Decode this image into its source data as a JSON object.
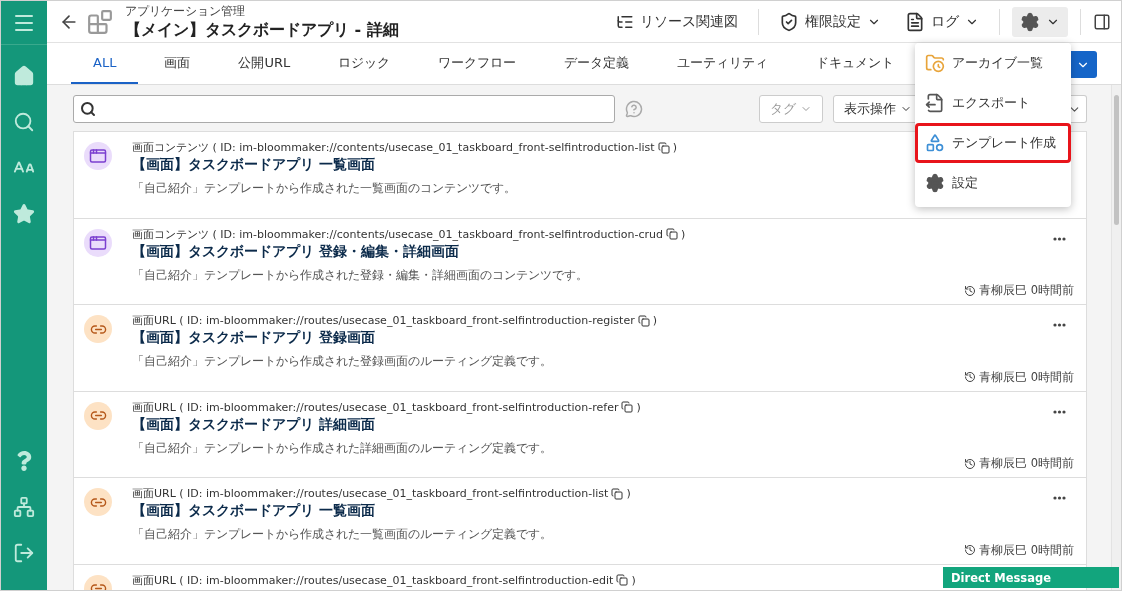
{
  "header": {
    "breadcrumb": "アプリケーション管理",
    "title": "【メイン】タスクボードアプリ - 詳細",
    "actions": [
      {
        "kind": "diagram",
        "label": "リソース関連図",
        "dropdown": false,
        "open": false
      },
      {
        "kind": "permissions",
        "label": "権限設定",
        "dropdown": true,
        "open": false
      },
      {
        "kind": "log",
        "label": "ログ",
        "dropdown": true,
        "open": false
      },
      {
        "kind": "settings",
        "dropdown": true,
        "open": true
      }
    ]
  },
  "tabs": [
    {
      "label": "ALL",
      "selected": true
    },
    {
      "label": "画面",
      "selected": false
    },
    {
      "label": "公開URL",
      "selected": false
    },
    {
      "label": "ロジック",
      "selected": false
    },
    {
      "label": "ワークフロー",
      "selected": false
    },
    {
      "label": "データ定義",
      "selected": false
    },
    {
      "label": "ユーティリティ",
      "selected": false
    },
    {
      "label": "ドキュメント",
      "selected": false
    }
  ],
  "toolbar": {
    "tag_filter": {
      "label": "タグ",
      "disabled": true
    },
    "view_menu": {
      "label": "表示操作",
      "disabled": false
    }
  },
  "settings_menu": {
    "items": [
      {
        "kind": "archive",
        "label": "アーカイブ一覧",
        "highlighted": false
      },
      {
        "kind": "export",
        "label": "エクスポート",
        "highlighted": false
      },
      {
        "kind": "template",
        "label": "テンプレート作成",
        "highlighted": true
      },
      {
        "kind": "settings",
        "label": "設定",
        "highlighted": false
      }
    ]
  },
  "items": [
    {
      "kind": "content",
      "meta": "画面コンテンツ ( ID: im-bloommaker://contents/usecase_01_taskboard_front-selfintroduction-list",
      "meta_end": ")",
      "title": "【画面】タスクボードアプリ 一覧画面",
      "description": "「自己紹介」テンプレートから作成された一覧画面のコンテンツです。"
    },
    {
      "kind": "content",
      "meta": "画面コンテンツ ( ID: im-bloommaker://contents/usecase_01_taskboard_front-selfintroduction-crud",
      "meta_end": ")",
      "title": "【画面】タスクボードアプリ 登録・編集・詳細画面",
      "description": "「自己紹介」テンプレートから作成された登録・編集・詳細画面のコンテンツです。",
      "updated": "青柳辰巳 0時間前"
    },
    {
      "kind": "route",
      "meta": "画面URL ( ID: im-bloommaker://routes/usecase_01_taskboard_front-selfintroduction-register",
      "meta_end": ")",
      "title": "【画面】タスクボードアプリ 登録画面",
      "description": "「自己紹介」テンプレートから作成された登録画面のルーティング定義です。",
      "updated": "青柳辰巳 0時間前"
    },
    {
      "kind": "route",
      "meta": "画面URL ( ID: im-bloommaker://routes/usecase_01_taskboard_front-selfintroduction-refer",
      "meta_end": ")",
      "title": "【画面】タスクボードアプリ 詳細画面",
      "description": "「自己紹介」テンプレートから作成された詳細画面のルーティング定義です。",
      "updated": "青柳辰巳 0時間前"
    },
    {
      "kind": "route",
      "meta": "画面URL ( ID: im-bloommaker://routes/usecase_01_taskboard_front-selfintroduction-list",
      "meta_end": ")",
      "title": "【画面】タスクボードアプリ 一覧画面",
      "description": "「自己紹介」テンプレートから作成された一覧画面のルーティング定義です。",
      "updated": "青柳辰巳 0時間前"
    },
    {
      "kind": "route",
      "meta": "画面URL ( ID: im-bloommaker://routes/usecase_01_taskboard_front-selfintroduction-edit",
      "meta_end": ")"
    }
  ],
  "chat": {
    "label": "Direct Message"
  }
}
